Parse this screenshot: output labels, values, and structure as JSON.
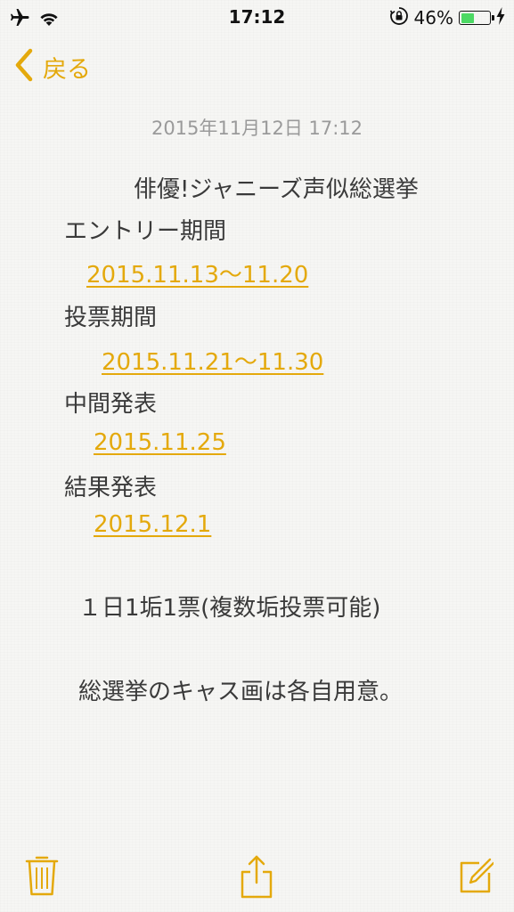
{
  "status_bar": {
    "time": "17:12",
    "battery_percent": "46%",
    "battery_level": 0.46,
    "icons": [
      "airplane-icon",
      "wifi-icon",
      "orientation-lock-icon",
      "battery-icon",
      "charging-bolt-icon"
    ]
  },
  "nav": {
    "back_label": "戻る"
  },
  "note": {
    "date": "2015年11月12日 17:12",
    "title": "俳優!ジャニーズ声似総選挙",
    "entry_label": "エントリー期間",
    "entry_dates": "2015.11.13〜11.20",
    "vote_label": "投票期間",
    "vote_dates": "2015.11.21〜11.30",
    "midterm_label": "中間発表",
    "midterm_date": "2015.11.25",
    "result_label": "結果発表",
    "result_date": "2015.12.1",
    "rule": "１日1垢1票(複数垢投票可能)",
    "footer": "総選挙のキャス画は各自用意。"
  },
  "toolbar": {
    "icons": [
      "trash-icon",
      "share-icon",
      "compose-icon"
    ]
  },
  "colors": {
    "accent": "#e4a90c",
    "background": "#f6f6f4",
    "text": "#3a3a3a",
    "date_text": "#9a9a9a",
    "battery_green": "#4cd964"
  }
}
